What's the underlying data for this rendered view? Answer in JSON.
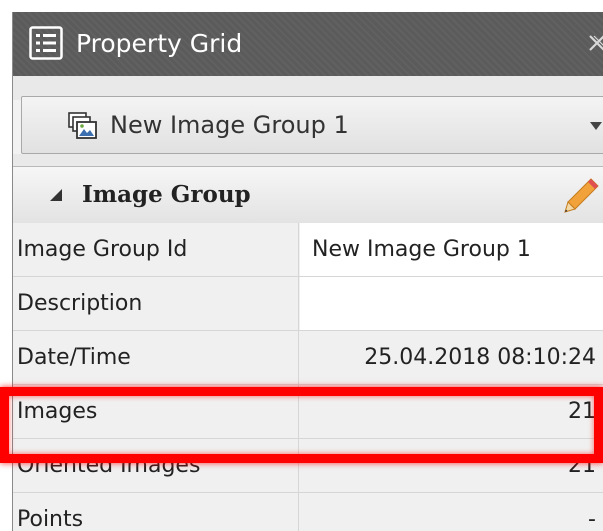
{
  "window": {
    "title": "Property Grid",
    "title_icon": "list-icon",
    "close_icon": "close-icon"
  },
  "selector": {
    "icon": "image-group-icon",
    "value": "New Image Group 1",
    "dropdown_icon": "chevron-down-icon"
  },
  "category": {
    "label": "Image Group",
    "expanded": true,
    "collapse_icon": "triangle-collapse-icon",
    "edit_icon": "pencil-icon"
  },
  "properties": [
    {
      "name": "Image Group Id",
      "value": "New Image Group 1"
    },
    {
      "name": "Description",
      "value": ""
    },
    {
      "name": "Date/Time",
      "value": "25.04.2018 08:10:24"
    },
    {
      "name": "Images",
      "value": "21"
    },
    {
      "name": "Oriented Images",
      "value": "21",
      "highlighted": true
    },
    {
      "name": "Points",
      "value": "-"
    }
  ],
  "colors": {
    "titlebar": "#5b5b5b",
    "highlight": "#ff0000",
    "pencil": "#f2a23a"
  }
}
